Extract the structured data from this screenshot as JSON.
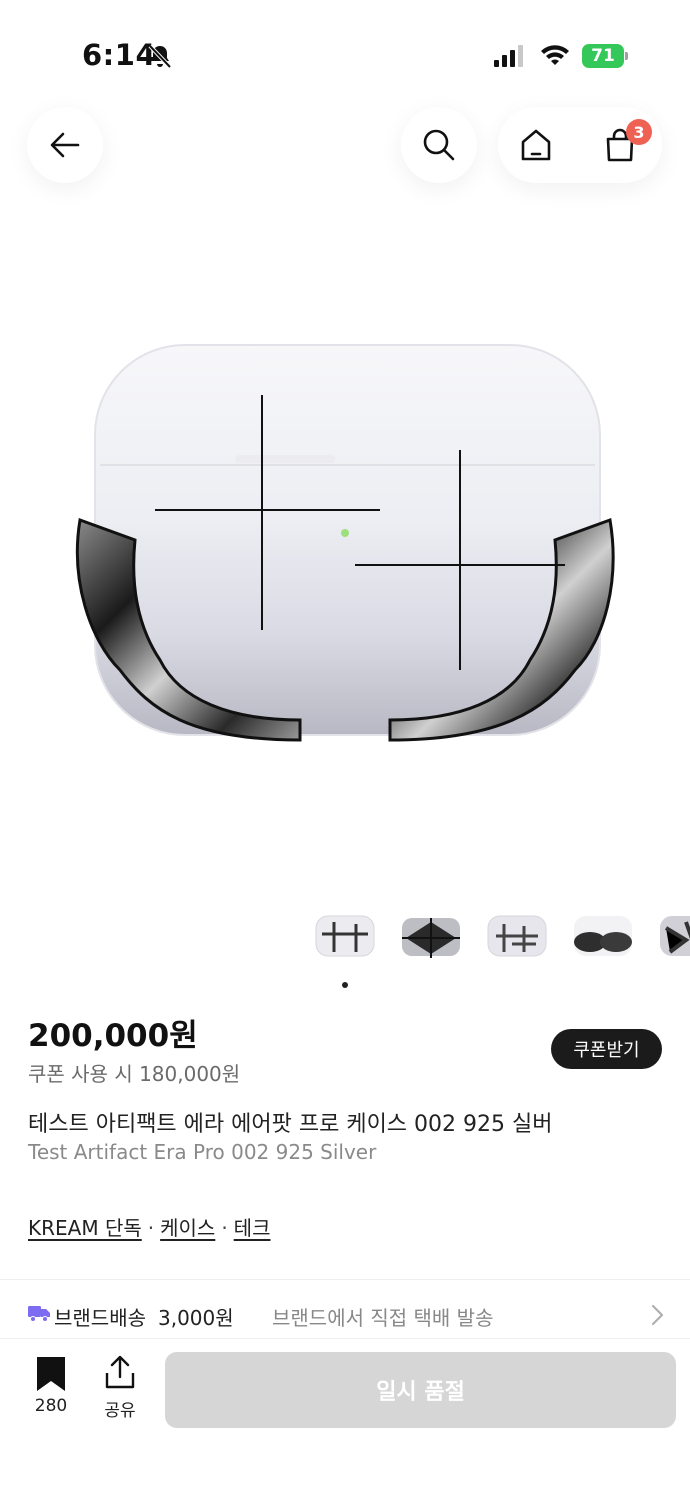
{
  "status_bar": {
    "time": "6:14",
    "battery": "71"
  },
  "header": {
    "cart_count": "3"
  },
  "gallery": {
    "thumbnail_count": 5,
    "current_page": 1
  },
  "product": {
    "price": "200,000원",
    "coupon_price": "쿠폰 사용 시 180,000원",
    "coupon_button": "쿠폰받기",
    "title_ko": "테스트 아티팩트 에라 에어팟 프로 케이스 002 925 실버",
    "title_en": "Test Artifact Era Pro 002 925 Silver"
  },
  "tags": [
    "KREAM 단독",
    "케이스",
    "테크"
  ],
  "delivery": {
    "label": "브랜드배송",
    "price": "3,000원",
    "description": "브랜드에서 직접 택배 발송"
  },
  "bottom_bar": {
    "save_count": "280",
    "share_label": "공유",
    "buy_label": "일시 품절"
  },
  "colors": {
    "coupon_button_bg": "#1b1b1b",
    "cart_badge": "#ef6253",
    "battery": "#34c759",
    "truck_icon": "#7b6cf2",
    "soldout_button_bg": "#d6d6d6"
  }
}
